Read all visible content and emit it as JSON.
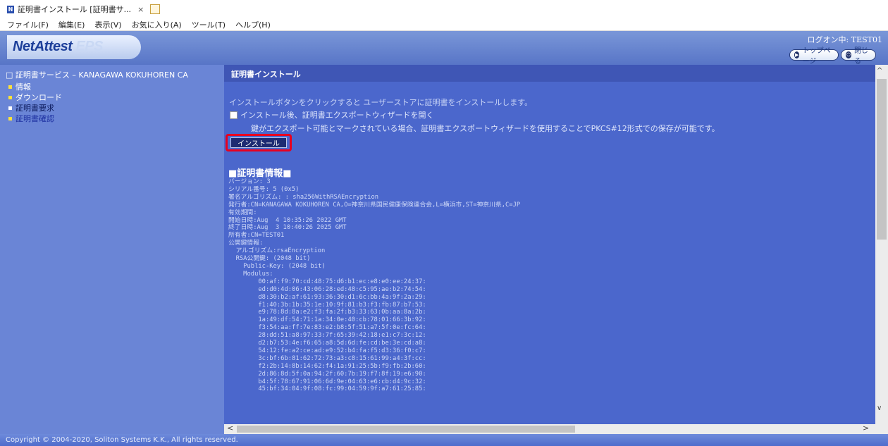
{
  "browser": {
    "tab_title": "証明書インストール [証明書サ...",
    "tab_close": "×",
    "favicon_letter": "N",
    "menu": [
      "ファイル(F)",
      "編集(E)",
      "表示(V)",
      "お気に入り(A)",
      "ツール(T)",
      "ヘルプ(H)"
    ]
  },
  "header": {
    "logo_main": "NetAttest",
    "logo_sub": "EPS",
    "logon_status": "ログオン中: TEST01",
    "top_page_button": "トップページ",
    "close_button": "閉じる"
  },
  "sidebar": {
    "title": "証明書サービス – KANAGAWA KOKUHOREN CA",
    "items": [
      {
        "label": "情報",
        "color": "#ffffff",
        "bullet": "#ffe23a"
      },
      {
        "label": "ダウンロード",
        "color": "#ffffff",
        "bullet": "#ffe23a"
      },
      {
        "label": "証明書要求",
        "color": "#0c1a5c",
        "bullet": "#ffffff"
      },
      {
        "label": "証明書確認",
        "color": "#1c2fa0",
        "bullet": "#ffe23a"
      }
    ]
  },
  "main": {
    "title": "証明書インストール",
    "info": "インストールボタンをクリックすると ユーザーストアに証明書をインストールします。",
    "checkbox_label": "インストール後、証明書エクスポートウィザードを開く",
    "note": "鍵がエクスポート可能とマークされている場合、証明書エクスポートウィザードを使用することでPKCS#12形式での保存が可能です。",
    "install_button": "インストール",
    "cert_heading": "■証明書情報■",
    "cert_lines": [
      "バージョン: 3",
      "シリアル番号: 5 (0x5)",
      "署名アルゴリズム: : sha256WithRSAEncryption",
      "発行者:CN=KANAGAWA KOKUHOREN CA,O=神奈川県国民健康保険連合会,L=横浜市,ST=神奈川県,C=JP",
      "有効期間:",
      "開始日時:Aug  4 10:35:26 2022 GMT",
      "終了日時:Aug  3 10:40:26 2025 GMT",
      "所有者:CN=TEST01",
      "公開鍵情報:",
      "  アルゴリズム:rsaEncryption",
      "  RSA公開鍵: (2048 bit)",
      "    Public-Key: (2048 bit)",
      "    Modulus:",
      "        00:af:f9:70:cd:48:75:d6:b1:ec:e8:e0:ee:24:37:",
      "        ed:d0:4d:06:43:06:28:ed:48:c5:95:ae:b2:74:54:",
      "        d8:30:b2:af:61:93:36:30:d1:6c:bb:4a:9f:2a:29:",
      "        f1:40:3b:1b:35:1e:10:9f:81:b3:f3:fb:87:b7:53:",
      "        e9:78:8d:8a:e2:f3:fa:2f:b3:33:63:0b:aa:8a:2b:",
      "        1a:49:df:54:71:1a:34:0e:40:cb:78:01:66:3b:92:",
      "        f3:54:aa:ff:7e:83:e2:b8:5f:51:a7:5f:0e:fc:64:",
      "        28:dd:51:a8:97:33:7f:65:39:42:18:e1:c7:3c:12:",
      "        d2:b7:53:4e:f6:65:a8:5d:6d:fe:cd:be:3e:cd:a8:",
      "        54:12:fe:a2:ce:ad:e9:52:b4:fa:f5:d3:36:f0:c7:",
      "        3c:bf:6b:81:62:72:73:a3:c8:15:61:99:a4:3f:cc:",
      "        f2:2b:14:8b:14:62:f4:1a:91:25:5b:f9:fb:2b:60:",
      "        2d:86:8d:5f:0a:94:2f:60:7b:19:f7:8f:19:e6:90:",
      "        b4:5f:78:67:91:06:6d:9e:04:63:e6:cb:d4:9c:32:",
      "        45:bf:34:04:9f:08:fc:99:04:59:9f:a7:61:25:85:"
    ]
  },
  "footer": {
    "copyright": "Copyright © 2004-2020, Soliton Systems K.K., All rights reserved."
  }
}
